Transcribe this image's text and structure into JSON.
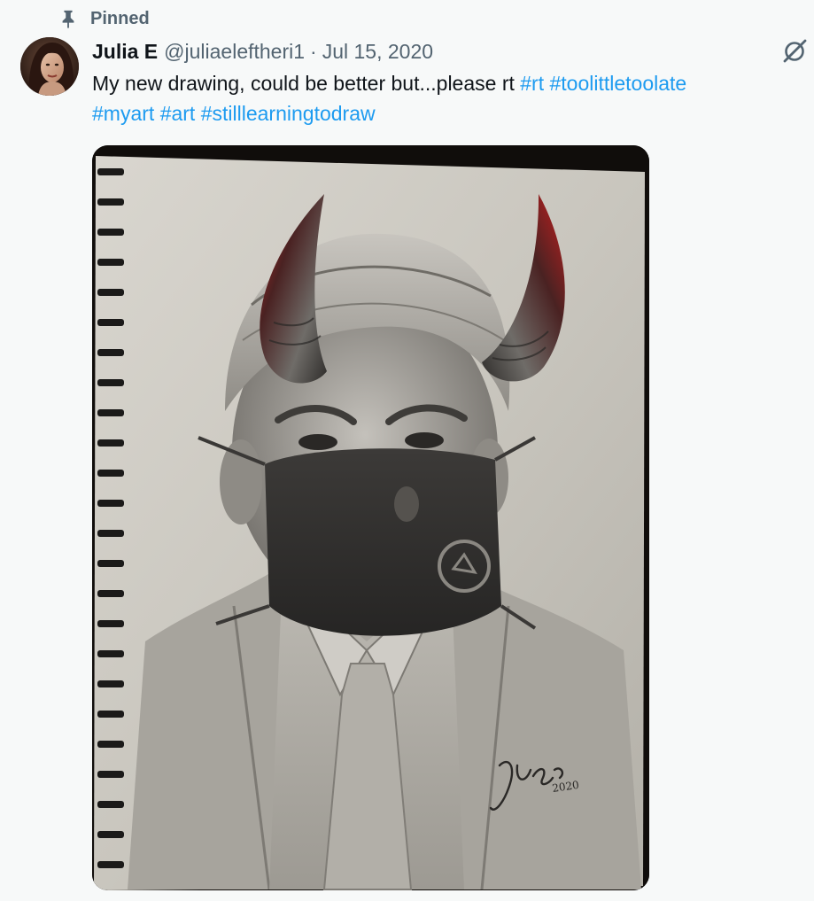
{
  "pinned": {
    "label": "Pinned",
    "icon": "pin-icon"
  },
  "author": {
    "display_name": "Julia E",
    "handle": "@juliaeleftheri1",
    "separator": "·",
    "date": "Jul 15, 2020",
    "avatar_icon": "avatar-photo"
  },
  "tweet": {
    "text_plain": "My new drawing, could be better but...please rt ",
    "hashtags": [
      "#rt",
      "#toolittletoolate",
      "#myart",
      "#art",
      "#stilllearningtodraw"
    ]
  },
  "media": {
    "kind": "image",
    "description_icon": "pencil-drawing-image",
    "signature": "Jules 2020"
  },
  "actions": {
    "grok_icon": "grok-icon"
  },
  "colors": {
    "background": "#f7f9f9",
    "text": "#0f1419",
    "secondary": "#536471",
    "link": "#1d9bf0"
  }
}
